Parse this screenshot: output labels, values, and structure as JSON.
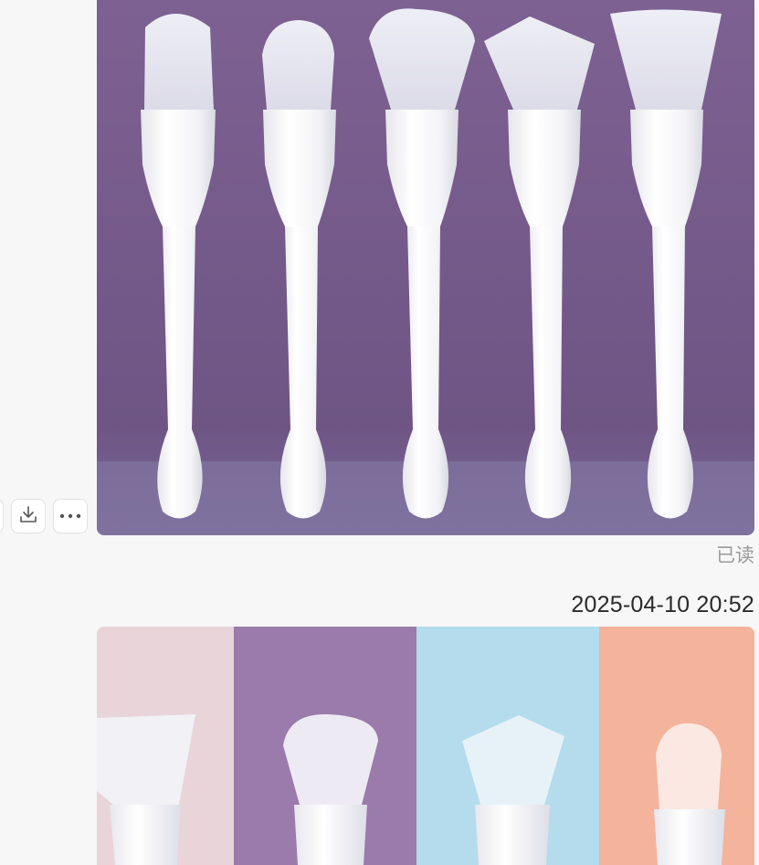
{
  "messages": [
    {
      "type": "image",
      "subject": "five white silicone face mask brushes on purple background",
      "read_status": "已读"
    },
    {
      "type": "image",
      "timestamp": "2025-04-10 20:52",
      "subject": "four silicone brushes on pink, purple, blue and peach panels"
    }
  ],
  "actions": {
    "download_icon": "download-icon",
    "more_icon": "more-icon"
  },
  "colors": {
    "background": "#f7f7f7",
    "purple_backdrop": "#7b5d8a",
    "panel_pink": "#e8d3d8",
    "panel_purple": "#9779a8",
    "panel_blue": "#b3dceb",
    "panel_peach": "#f4b49c"
  }
}
